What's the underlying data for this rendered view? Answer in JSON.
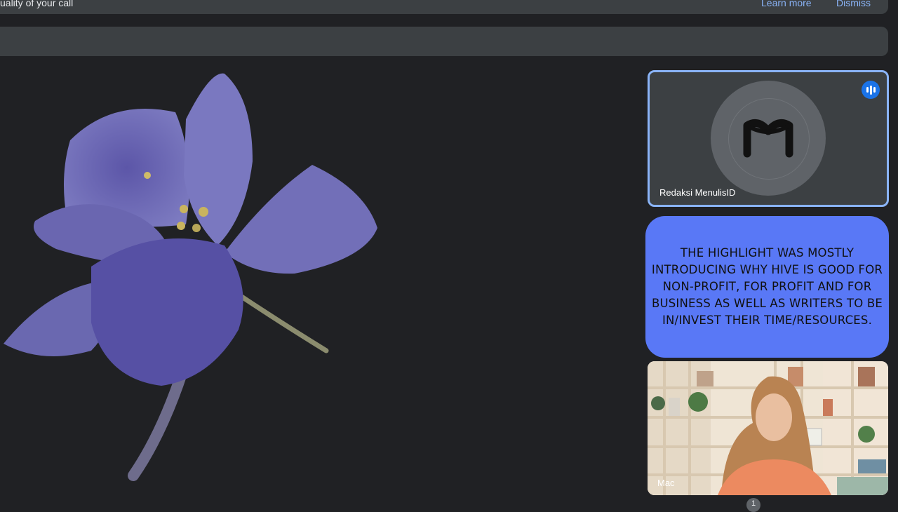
{
  "banner": {
    "text": "uality of your call",
    "learn_more": "Learn more",
    "dismiss": "Dismiss"
  },
  "participants": {
    "active": {
      "name": "Redaksi MenulisID",
      "avatar_letter": "M",
      "speaking": true
    },
    "second": {
      "name": "Mac"
    }
  },
  "caption": {
    "text": "THE HIGHLIGHT WAS MOSTLY INTRODUCING WHY HIVE IS GOOD FOR NON-PROFIT, FOR PROFIT AND FOR BUSINESS AS WELL AS WRITERS TO BE IN/INVEST THEIR TIME/RESOURCES."
  },
  "pager": {
    "label": "1"
  },
  "colors": {
    "background": "#202124",
    "surface": "#3c4043",
    "accent": "#8ab4f8",
    "caption_bg": "#5978f6",
    "flower": "#6e6ab0"
  }
}
